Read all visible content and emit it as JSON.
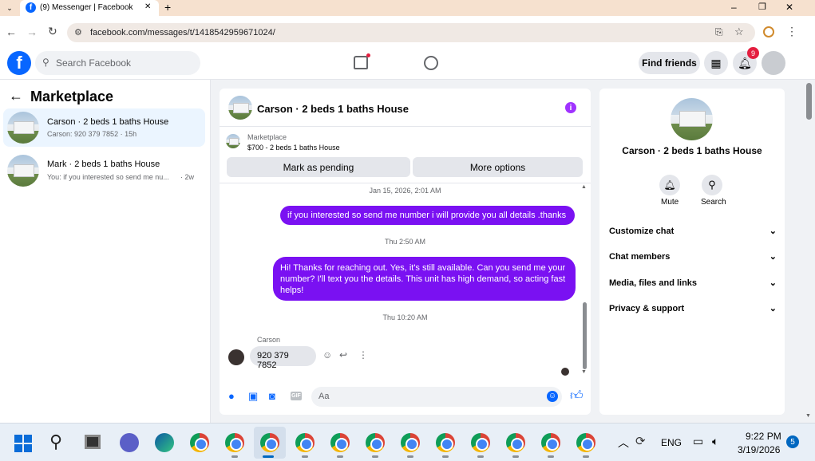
{
  "browser": {
    "tab_title": "(9) Messenger | Facebook",
    "url": "facebook.com/messages/t/1418542959671024/",
    "new_tab": "+",
    "minimize": "–",
    "restore": "❐",
    "close": "✕"
  },
  "fb_header": {
    "search_placeholder": "Search Facebook",
    "find_friends": "Find friends",
    "notification_count": "9"
  },
  "left": {
    "title": "Marketplace",
    "conversations": [
      {
        "name": "Carson · 2 beds 1 baths House",
        "preview": "Carson: 920 379 7852 · 15h"
      },
      {
        "name": "Mark · 2 beds 1 baths House",
        "preview": "You: if you interested so send me nu...",
        "time": "· 2w"
      }
    ]
  },
  "chat": {
    "title": "Carson · 2 beds 1 baths House",
    "listing_source": "Marketplace",
    "listing_info": "$700 - 2 beds 1 baths House",
    "mark_pending": "Mark as pending",
    "more_options": "More options",
    "messages": [
      {
        "type": "timestamp",
        "text": "Jan 15, 2026, 2:01 AM"
      },
      {
        "type": "out",
        "text": "if you interested so send me number i will provide you all details .thanks"
      },
      {
        "type": "timestamp",
        "text": "Thu 2:50 AM"
      },
      {
        "type": "out",
        "text": "Hi! Thanks for reaching out. Yes, it's still available. Can you send me your number? I'll text you the details. This unit has high demand, so acting fast helps!"
      },
      {
        "type": "timestamp",
        "text": "Thu 10:20 AM"
      },
      {
        "type": "sender",
        "text": "Carson"
      },
      {
        "type": "in",
        "text": "920 379 7852"
      }
    ],
    "composer_placeholder": "Aa",
    "gif_label": "GIF"
  },
  "info": {
    "title": "Carson · 2 beds 1 baths House",
    "mute": "Mute",
    "search": "Search",
    "sections": [
      "Customize chat",
      "Chat members",
      "Media, files and links",
      "Privacy & support"
    ]
  },
  "taskbar": {
    "lang": "ENG",
    "time": "9:22 PM",
    "date": "3/19/2026",
    "notif": "5"
  },
  "colors": {
    "brand": "#0866ff",
    "accent": "#7a11f2"
  }
}
